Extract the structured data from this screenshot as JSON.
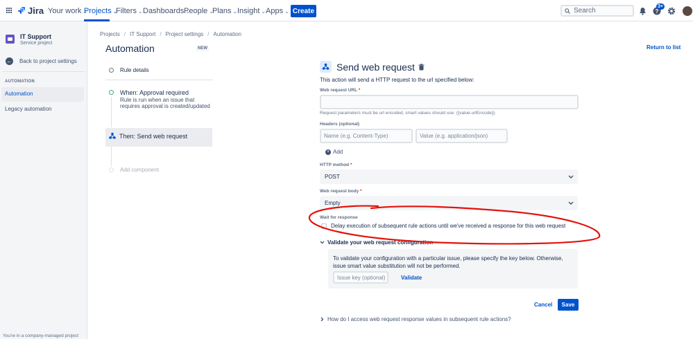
{
  "topnav": {
    "logo": "Jira",
    "items": [
      {
        "label": "Your work",
        "active": false
      },
      {
        "label": "Projects",
        "active": true
      },
      {
        "label": "Filters",
        "active": false
      },
      {
        "label": "Dashboards",
        "active": false
      },
      {
        "label": "People",
        "active": false
      },
      {
        "label": "Plans",
        "active": false
      },
      {
        "label": "Insight",
        "active": false
      },
      {
        "label": "Apps",
        "active": false
      }
    ],
    "create_label": "Create",
    "search_placeholder": "Search",
    "help_badge": "3+",
    "accent": "#0052cc"
  },
  "sidebar": {
    "project_name": "IT Support",
    "project_type": "Service project",
    "back_label": "Back to project settings",
    "section_label": "AUTOMATION",
    "items": [
      {
        "label": "Automation",
        "active": true
      },
      {
        "label": "Legacy automation",
        "active": false
      }
    ],
    "footer": "You're in a company-managed project"
  },
  "breadcrumbs": [
    "Projects",
    "IT Support",
    "Project settings",
    "Automation"
  ],
  "page": {
    "title": "Automation",
    "lozenge": "NEW",
    "return_link": "Return to list"
  },
  "rule": {
    "details_label": "Rule details",
    "trigger_title": "When: Approval required",
    "trigger_desc": "Rule is run when an issue that requires approval is created/updated",
    "action_label": "Then: Send web request",
    "add_component": "Add component"
  },
  "form": {
    "title": "Send web request",
    "description": "This action will send a HTTP request to the url specified below:",
    "url_label": "Web request URL",
    "url_value": "",
    "url_help": "Request parameters must be url encoded, smart values should use: {{value.urlEncode}}.",
    "headers_label": "Headers (optional)",
    "header_name_placeholder": "Name (e.g. Content-Type)",
    "header_value_placeholder": "Value (e.g. application/json)",
    "add_label": "Add",
    "method_label": "HTTP method",
    "method_value": "POST",
    "body_label": "Web request body",
    "body_value": "Empty",
    "wait_label": "Wait for response",
    "wait_checkbox": "Delay execution of subsequent rule actions until we've received a response for this web request",
    "wait_checked": false,
    "validate_heading": "Validate your web request configuration",
    "validate_text": "To validate your configuration with a particular issue, please specify the key below. Otherwise, issue smart value substitution will not be performed.",
    "issue_key_placeholder": "Issue key (optional)",
    "validate_button": "Validate",
    "cancel_label": "Cancel",
    "save_label": "Save",
    "faq": "How do I access web request response values in subsequent rule actions?"
  },
  "annotation_color": "#e3120b"
}
